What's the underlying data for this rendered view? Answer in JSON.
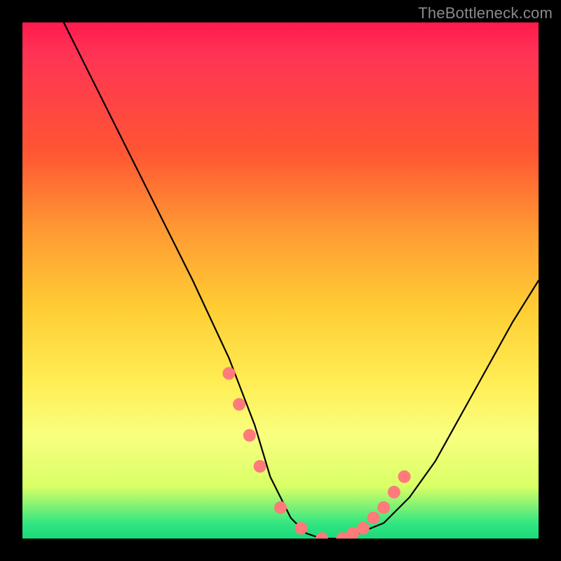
{
  "watermark": "TheBottleneck.com",
  "chart_data": {
    "type": "line",
    "title": "",
    "xlabel": "",
    "ylabel": "",
    "xlim": [
      0,
      100
    ],
    "ylim": [
      0,
      100
    ],
    "series": [
      {
        "name": "curve",
        "x": [
          8,
          12,
          18,
          25,
          33,
          40,
          45,
          48,
          52,
          55,
          58,
          62,
          65,
          70,
          75,
          80,
          85,
          90,
          95,
          100
        ],
        "y": [
          100,
          92,
          80,
          66,
          50,
          35,
          22,
          12,
          4,
          1,
          0,
          0,
          1,
          3,
          8,
          15,
          24,
          33,
          42,
          50
        ]
      }
    ],
    "markers": {
      "name": "highlight-points",
      "color": "#ff7a7a",
      "x": [
        40,
        42,
        44,
        46,
        50,
        54,
        58,
        62,
        64,
        66,
        68,
        70,
        72,
        74
      ],
      "y": [
        32,
        26,
        20,
        14,
        6,
        2,
        0,
        0,
        1,
        2,
        4,
        6,
        9,
        12
      ]
    },
    "background_gradient": {
      "stops": [
        {
          "pos": 0.0,
          "color": "#ff1a4d"
        },
        {
          "pos": 0.25,
          "color": "#ff5533"
        },
        {
          "pos": 0.55,
          "color": "#ffcc33"
        },
        {
          "pos": 0.8,
          "color": "#f9ff7f"
        },
        {
          "pos": 1.0,
          "color": "#1ad97a"
        }
      ]
    }
  }
}
